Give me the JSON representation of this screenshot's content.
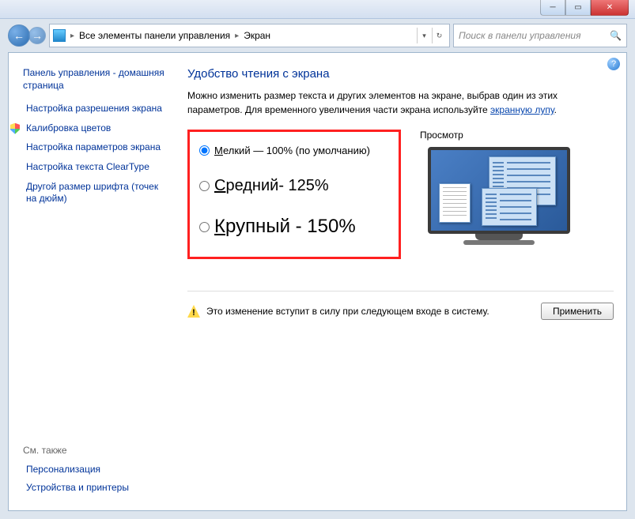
{
  "breadcrumbs": {
    "item1": "Все элементы панели управления",
    "item2": "Экран"
  },
  "search": {
    "placeholder": "Поиск в панели управления"
  },
  "sidebar": {
    "home": "Панель управления - домашняя страница",
    "items": {
      "resolution": "Настройка разрешения экрана",
      "calibration": "Калибровка цветов",
      "display_params": "Настройка параметров экрана",
      "cleartype": "Настройка текста ClearType",
      "dpi": "Другой размер шрифта (точек на дюйм)"
    },
    "see_also": "См. также",
    "bottom": {
      "personalization": "Персонализация",
      "devices": "Устройства и принтеры"
    }
  },
  "page": {
    "title": "Удобство чтения с экрана",
    "desc_part1": "Можно изменить размер текста и других элементов на экране, выбрав один из этих параметров. Для временного увеличения части экрана используйте ",
    "desc_link": "экранную лупу",
    "desc_part2": "."
  },
  "options": {
    "preview_label": "Просмотр",
    "small_letter": "М",
    "small_rest": "елкий — 100% (по умолчанию)",
    "medium_letter": "С",
    "medium_rest": "редний- 125%",
    "large_letter": "К",
    "large_rest": "рупный - 150%"
  },
  "footer": {
    "warning": "Это изменение вступит в силу при следующем входе в систему.",
    "apply": "Применить"
  }
}
